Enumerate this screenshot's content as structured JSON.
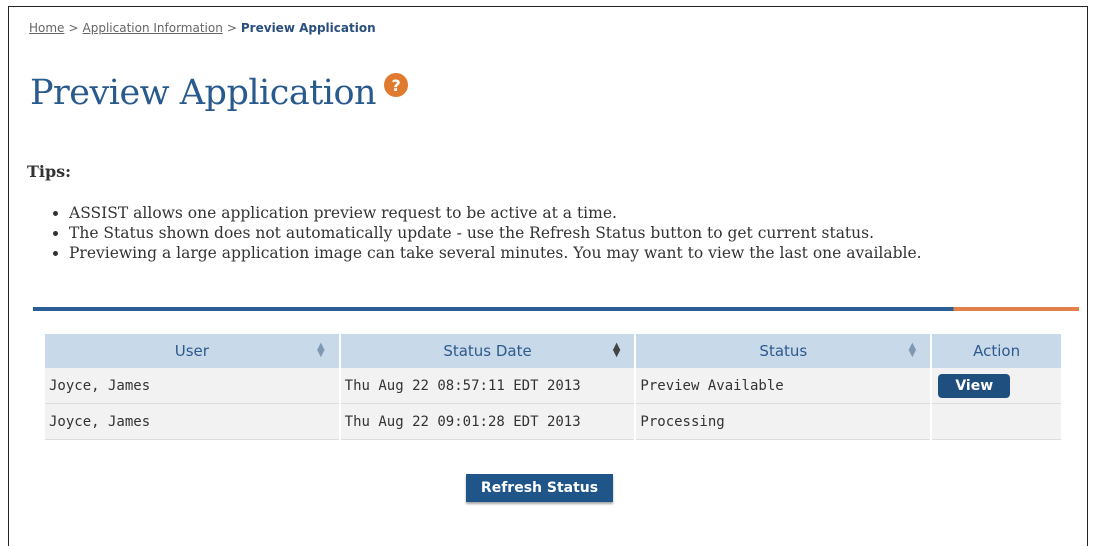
{
  "breadcrumb": {
    "home": "Home",
    "app_info": "Application Information",
    "current": "Preview Application",
    "separator": ">"
  },
  "page": {
    "title": "Preview Application",
    "help_icon_label": "?"
  },
  "tips": {
    "label": "Tips:",
    "items": [
      "ASSIST allows one application preview request to be active at a time.",
      "The Status shown does not automatically update - use the Refresh Status button to get current status.",
      "Previewing a large application image can take several minutes.  You may want to view the last one available."
    ]
  },
  "table": {
    "headers": [
      "User",
      "Status Date",
      "Status",
      "Action"
    ],
    "rows": [
      {
        "user": "Joyce, James",
        "status_date": "Thu Aug 22 08:57:11 EDT 2013",
        "status": "Preview Available",
        "action": "View"
      },
      {
        "user": "Joyce, James",
        "status_date": "Thu Aug 22 09:01:28 EDT 2013",
        "status": "Processing",
        "action": ""
      }
    ]
  },
  "buttons": {
    "refresh": "Refresh Status"
  },
  "colors": {
    "accent_blue": "#285a8e",
    "accent_orange": "#e07a2e",
    "header_bg": "#c8d9ea",
    "button_bg": "#1f5588"
  },
  "icons": {
    "help": "help-circle-icon",
    "sort": "sort-arrows-icon"
  }
}
